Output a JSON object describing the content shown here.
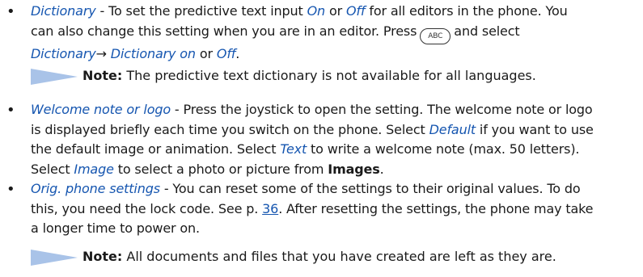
{
  "bullet_glyph": "•",
  "items": [
    {
      "term": "Dictionary",
      "l1_after_term": " - To set the predictive text input ",
      "l1_on": "On",
      "l1_or": " or ",
      "l1_off": "Off",
      "l1_tail": " for all editors in the phone. You",
      "l2_a": "can also change this setting when you are in an editor. Press",
      "key_label": "ABC",
      "l2_b": "and select",
      "l3_dict": "Dictionary",
      "l3_arrow": "→",
      "l3_dict_on": "Dictionary on",
      "l3_or": " or ",
      "l3_off": "Off",
      "l3_end": "."
    },
    {
      "term": "Welcome note or logo",
      "l1_tail": " - Press the joystick to open the setting. The welcome note or logo",
      "l2": "is displayed briefly each time you switch on the phone. Select ",
      "l2_default": "Default",
      "l2_tail": " if you want to use",
      "l3_a": "the default image or animation. Select ",
      "l3_text": "Text",
      "l3_tail": " to write a welcome note (max. 50 letters).",
      "l4_a": "Select ",
      "l4_image": "Image",
      "l4_b": " to select a photo or picture from ",
      "l4_images": "Images",
      "l4_end": "."
    },
    {
      "term": "Orig. phone settings",
      "l1_tail": " - You can reset some of the settings to their original values. To do",
      "l2_a": "this, you need the lock code. See p. ",
      "l2_page": "36",
      "l2_tail": ". After resetting the settings, the phone may take",
      "l3": "a longer time to power on."
    }
  ],
  "notes": [
    {
      "label": "Note:",
      "text": " The predictive text dictionary is not available for all languages."
    },
    {
      "label": "Note:",
      "text": " All documents and files that you have created are left as they are."
    }
  ],
  "colors": {
    "term": "#1656b0",
    "note_triangle": "#a9c3e8",
    "text": "#1a1a1a"
  }
}
